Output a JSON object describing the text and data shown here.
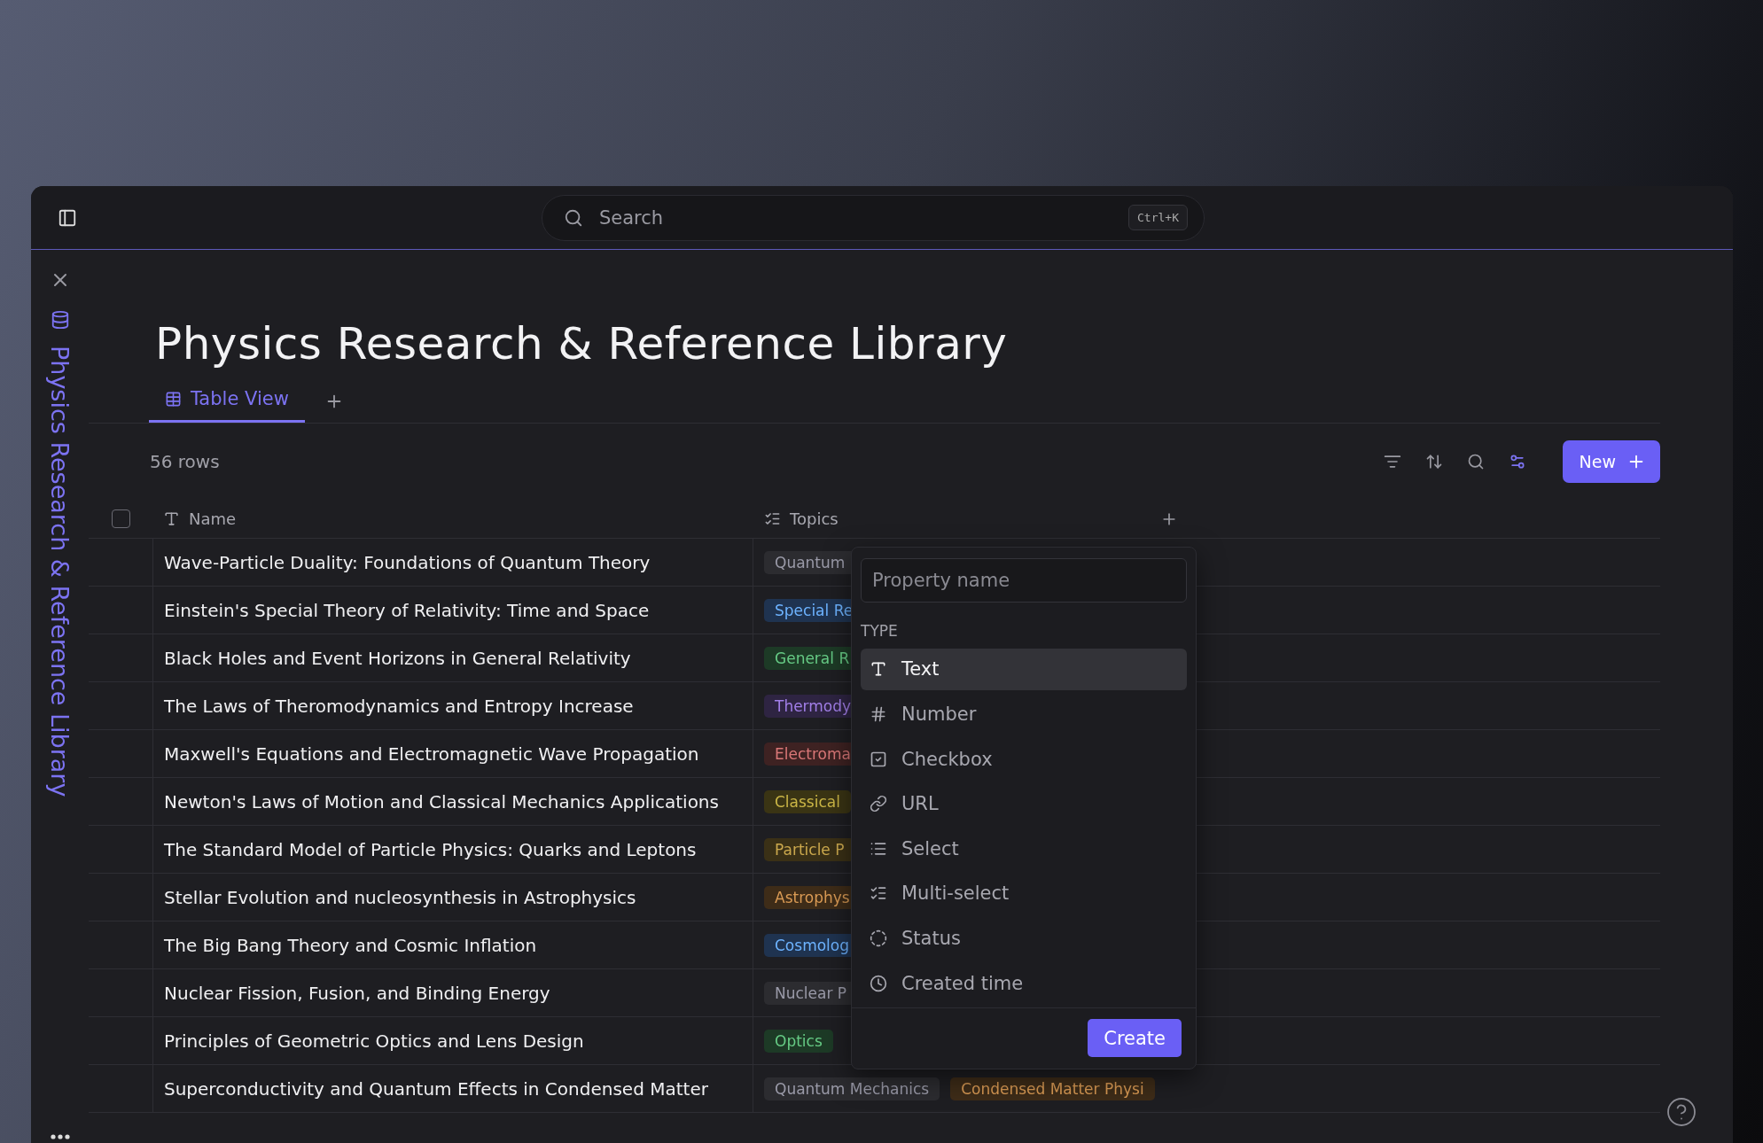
{
  "search": {
    "placeholder": "Search",
    "shortcut": "Ctrl+K"
  },
  "sidebar": {
    "title": "Physics Research & Reference Library"
  },
  "page": {
    "title": "Physics Research & Reference Library"
  },
  "tabs": [
    {
      "label": "Table View",
      "selected": true
    }
  ],
  "toolbar": {
    "row_count": "56 rows",
    "new_button": "New"
  },
  "table": {
    "select_all_checked": false,
    "columns": [
      {
        "label": "Name",
        "kind": "text"
      },
      {
        "label": "Topics",
        "kind": "multi_select"
      }
    ],
    "rows": [
      {
        "name": "Wave-Particle Duality: Foundations of Quantum Theory",
        "topics": [
          {
            "label": "Quantum",
            "color": "#2c2c30"
          }
        ]
      },
      {
        "name": "Einstein's Special Theory of Relativity: Time and Space",
        "topics": [
          {
            "label": "Special Re",
            "color": "#1f3350"
          }
        ]
      },
      {
        "name": "Black Holes and Event Horizons in General Relativity",
        "topics": [
          {
            "label": "General R",
            "color": "#1d3a26"
          }
        ]
      },
      {
        "name": "The Laws of Theromodynamics and Entropy Increase",
        "topics": [
          {
            "label": "Thermody",
            "color": "#2e2442"
          }
        ]
      },
      {
        "name": "Maxwell's Equations and Electromagnetic Wave Propagation",
        "topics": [
          {
            "label": "Electroma",
            "color": "#3e2222"
          }
        ]
      },
      {
        "name": "Newton's Laws of Motion and Classical Mechanics Applications",
        "topics": [
          {
            "label": "Classical",
            "color": "#3a3414"
          }
        ]
      },
      {
        "name": "The Standard Model of Particle Physics: Quarks and Leptons",
        "topics": [
          {
            "label": "Particle P",
            "color": "#3a3016"
          }
        ]
      },
      {
        "name": "Stellar Evolution and nucleosynthesis in Astrophysics",
        "topics": [
          {
            "label": "Astrophys",
            "color": "#3e2c18"
          }
        ]
      },
      {
        "name": "The Big Bang Theory and Cosmic Inflation",
        "topics": [
          {
            "label": "Cosmolog",
            "color": "#1f3350"
          }
        ]
      },
      {
        "name": "Nuclear Fission, Fusion, and Binding Energy",
        "topics": [
          {
            "label": "Nuclear P",
            "color": "#2c2c30"
          }
        ]
      },
      {
        "name": "Principles of Geometric Optics and Lens Design",
        "topics": [
          {
            "label": "Optics",
            "color": "#1d3a26"
          }
        ]
      },
      {
        "name": "Superconductivity and Quantum Effects in Condensed Matter",
        "topics": [
          {
            "label": "Quantum Mechanics",
            "color": "#2c2c30"
          },
          {
            "label": "Condensed Matter Physi",
            "color": "#3e2c18"
          }
        ]
      }
    ]
  },
  "property_popover": {
    "placeholder": "Property name",
    "section_label": "TYPE",
    "types": [
      {
        "label": "Text",
        "kind": "text",
        "selected": true
      },
      {
        "label": "Number",
        "kind": "number",
        "selected": false
      },
      {
        "label": "Checkbox",
        "kind": "checkbox",
        "selected": false
      },
      {
        "label": "URL",
        "kind": "url",
        "selected": false
      },
      {
        "label": "Select",
        "kind": "select",
        "selected": false
      },
      {
        "label": "Multi-select",
        "kind": "multi_select",
        "selected": false
      },
      {
        "label": "Status",
        "kind": "status",
        "selected": false
      },
      {
        "label": "Created time",
        "kind": "created_time",
        "selected": false
      }
    ],
    "create_button": "Create"
  }
}
